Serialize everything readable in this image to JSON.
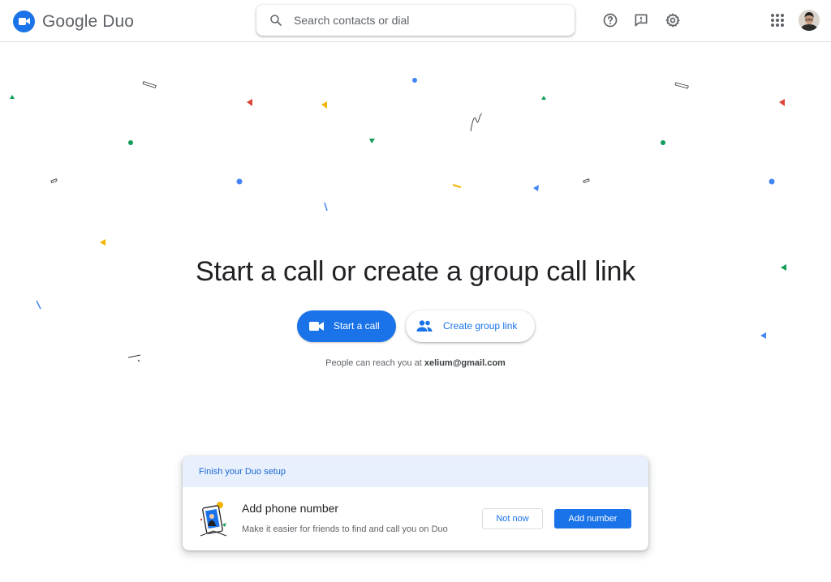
{
  "app": {
    "brand_name": "Google Duo",
    "accent": "#1a73e8"
  },
  "search": {
    "placeholder": "Search contacts or dial",
    "value": ""
  },
  "toolbar": {
    "icons": [
      "help-icon",
      "feedback-icon",
      "settings-icon",
      "apps-grid-icon",
      "avatar"
    ]
  },
  "hero": {
    "title": "Start a call or create a group call link",
    "start_call_label": "Start a call",
    "create_group_label": "Create group link",
    "reach_prefix": "People can reach you at",
    "reach_email": "xelium@gmail.com"
  },
  "setup_card": {
    "header": "Finish your Duo setup",
    "title": "Add phone number",
    "subtitle": "Make it easier for friends to find and call you on Duo",
    "not_now_label": "Not now",
    "add_number_label": "Add number"
  },
  "colors": {
    "blue": "#4285f4",
    "red": "#db4437",
    "yellow": "#f4b400",
    "green": "#0f9d58"
  }
}
